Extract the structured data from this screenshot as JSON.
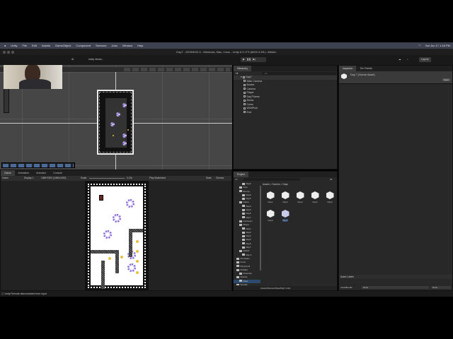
{
  "menubar": {
    "items": [
      "Unity",
      "File",
      "Edit",
      "Assets",
      "GameObject",
      "Component",
      "Services",
      "Jobs",
      "Window",
      "Help"
    ],
    "clock": "Sat Jun 17 1:18 PM"
  },
  "window": {
    "title": "Day7 - 2DSNKS2.0 - Windows, Mac, Linux - Unity 6.3 LTS (6000.3.3f1) <Metal>"
  },
  "toolbar": {
    "ai_label": "AI",
    "version_label": "Unity Versio...",
    "layout_label": "Layout"
  },
  "hierarchy": {
    "tab": "Hierarchy",
    "search_placeholder": "All",
    "root": "Day7",
    "items": [
      "Main Camera",
      "Border",
      "Cannon",
      "Player",
      "Day7Game",
      "Bricks",
      "Coins",
      "WhirlPool",
      "End"
    ]
  },
  "game": {
    "tabs": [
      "Game",
      "Animation",
      "Animator",
      "Console"
    ],
    "mode": "Game",
    "display": "Display 1",
    "resolution": "1080*1920 (1080x1920)",
    "scale_label": "Scale",
    "scale_value": "0.23x",
    "play_mode": "Play Maximized",
    "stats": "Stats",
    "gizmos": "Gizmos"
  },
  "project": {
    "tab": "Project",
    "count": "25",
    "breadcrumb": [
      "Assets",
      "Scenes",
      "Days"
    ],
    "tree": [
      "Day6",
      "Coin",
      "Enemy",
      "Day6",
      "Day5",
      "Game",
      "Day3",
      "Day4",
      "Day5",
      "Day7",
      "IceCream",
      "Player",
      "Day1",
      "Day2",
      "Day3",
      "Day5",
      "Day6",
      "Day7",
      "Switch",
      "Day 4",
      "Animation",
      "Fonts",
      "Physics M",
      "Prefabs",
      "PowerUp",
      "Scenes",
      "Days",
      "Sounds",
      "Music"
    ],
    "assets": [
      "Day1",
      "Day2",
      "Day3",
      "Day4",
      "Day5",
      "Day6",
      "Day7"
    ],
    "path": "Assets/Scenes/Days/Day7.unity"
  },
  "inspector": {
    "tabs": [
      "Inspector",
      "Tile Palette"
    ],
    "asset_title": "Day 7 (Scene Asset)",
    "open_button": "Open",
    "asset_labels": "Asset Labels",
    "asset_bundle_label": "AssetBundle",
    "bundle_value": "None",
    "variant_value": "None"
  },
  "status": {
    "message": "Unity Remote disconnected from input"
  },
  "colors": {
    "accent": "#3d5a8a",
    "orb": "#7b5bd0",
    "coin": "#e8c040"
  }
}
